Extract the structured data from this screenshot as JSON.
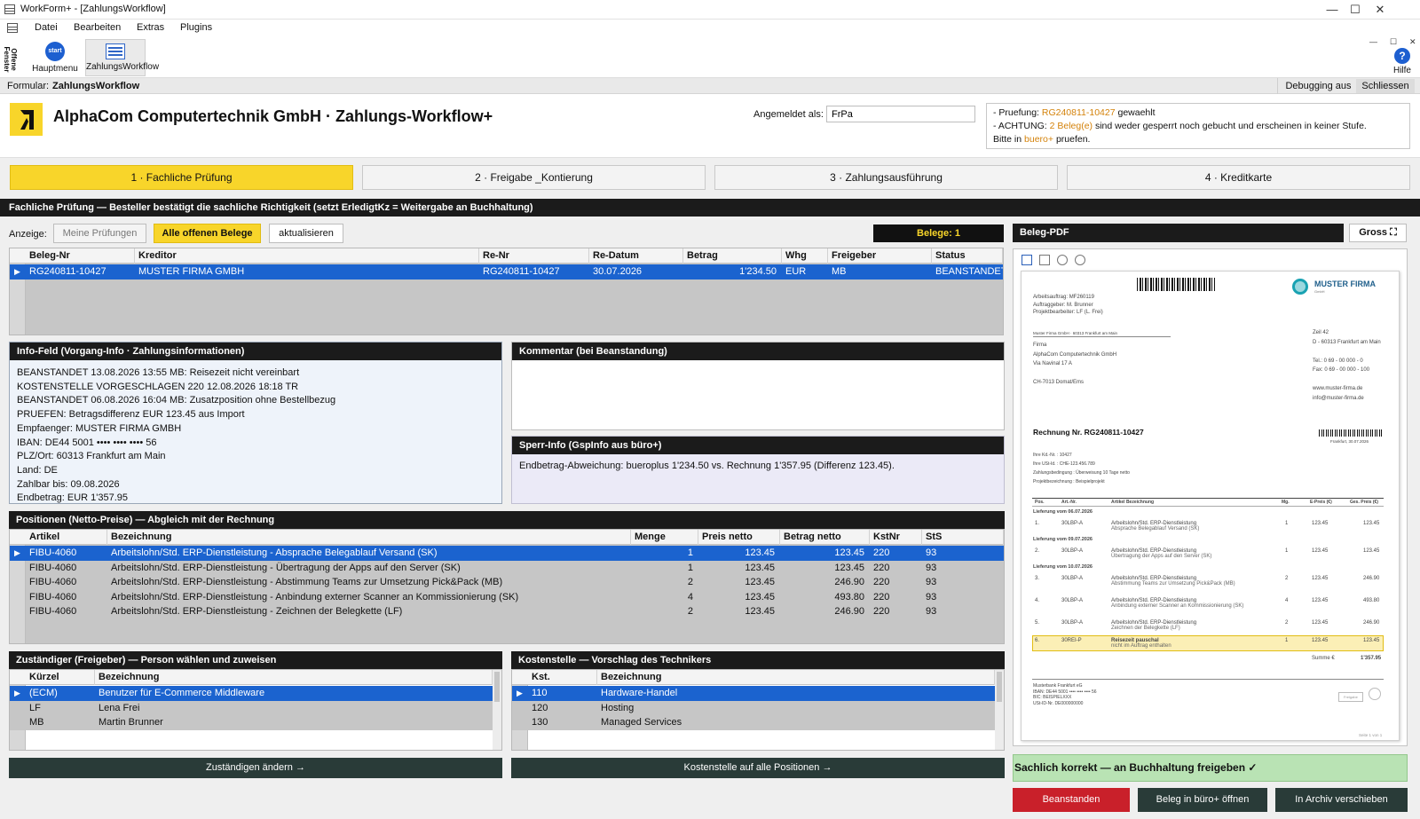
{
  "window": {
    "title": "WorkForm+ - [ZahlungsWorkflow]",
    "minimize": "—",
    "maximize": "☐",
    "close": "✕"
  },
  "menu": [
    "Datei",
    "Bearbeiten",
    "Extras",
    "Plugins"
  ],
  "toolbar": {
    "side_label": "Offene Fenster",
    "items": [
      {
        "label": "Hauptmenu",
        "icon_text": "start"
      },
      {
        "label": "ZahlungsWorkflow"
      }
    ],
    "help_label": "Hilfe",
    "help_glyph": "?",
    "mini_controls": [
      "—",
      "☐",
      "✕"
    ]
  },
  "formbar": {
    "prefix": "Formular:",
    "name": "ZahlungsWorkflow",
    "debug": "Debugging aus",
    "close": "Schliessen"
  },
  "header": {
    "title": "AlphaCom Computertechnik GmbH · Zahlungs-Workflow+",
    "login_label": "Angemeldet als:",
    "login_value": "FrPa",
    "messages": [
      {
        "pre": "- Pruefung: ",
        "hl": "RG240811-10427",
        "post": " gewaehlt"
      },
      {
        "pre": "- ACHTUNG: ",
        "hl": "2 Beleg(e)",
        "post": " sind weder gesperrt noch gebucht und erscheinen in keiner Stufe."
      },
      {
        "pre": "Bitte in ",
        "hl": "buero+",
        "post": " pruefen."
      }
    ]
  },
  "tabs": [
    "1 · Fachliche Prüfung",
    "2 · Freigabe _Kontierung",
    "3 · Zahlungsausführung",
    "4 · Kreditkarte"
  ],
  "banner": "Fachliche Prüfung — Besteller bestätigt die sachliche Richtigkeit (setzt ErledigtKz = Weitergabe an Buchhaltung)",
  "filter": {
    "label": "Anzeige:",
    "mine": "Meine Prüfungen",
    "all": "Alle offenen Belege",
    "refresh": "aktualisieren",
    "count": "Belege: 1"
  },
  "belege": {
    "columns": [
      "Beleg-Nr",
      "Kreditor",
      "Re-Nr",
      "Re-Datum",
      "Betrag",
      "Whg",
      "Freigeber",
      "Status"
    ],
    "rows": [
      [
        "RG240811-10427",
        "MUSTER FIRMA GMBH",
        "RG240811-10427",
        "30.07.2026",
        "1'234.50",
        "EUR",
        "MB",
        "BEANSTANDET"
      ]
    ]
  },
  "info": {
    "title": "Info-Feld (Vorgang-Info · Zahlungsinformationen)",
    "lines": [
      "BEANSTANDET 13.08.2026 13:55 MB: Reisezeit nicht vereinbart",
      "KOSTENSTELLE VORGESCHLAGEN 220 12.08.2026 18:18 TR",
      "BEANSTANDET 06.08.2026 16:04 MB: Zusatzposition ohne Bestellbezug",
      "PRUEFEN: Betragsdifferenz EUR 123.45 aus Import",
      "Empfaenger: MUSTER FIRMA GMBH",
      "IBAN: DE44 5001 •••• •••• •••• 56",
      "PLZ/Ort: 60313 Frankfurt am Main",
      "Land: DE",
      "Zahlbar bis: 09.08.2026",
      "Endbetrag: EUR 1'357.95"
    ]
  },
  "kommentar": {
    "title": "Kommentar (bei Beanstandung)",
    "text": ""
  },
  "sperr": {
    "title": "Sperr-Info (GspInfo aus büro+)",
    "text": "Endbetrag-Abweichung: bueroplus 1'234.50 vs. Rechnung 1'357.95 (Differenz 123.45)."
  },
  "positionen": {
    "title": "Positionen (Netto-Preise) — Abgleich mit der Rechnung",
    "columns": [
      "Artikel",
      "Bezeichnung",
      "Menge",
      "Preis netto",
      "Betrag netto",
      "KstNr",
      "StS"
    ],
    "rows": [
      [
        "FIBU-4060",
        "Arbeitslohn/Std. ERP-Dienstleistung - Absprache Belegablauf Versand (SK)",
        "1",
        "123.45",
        "123.45",
        "220",
        "93"
      ],
      [
        "FIBU-4060",
        "Arbeitslohn/Std. ERP-Dienstleistung - Übertragung der Apps auf den Server (SK)",
        "1",
        "123.45",
        "123.45",
        "220",
        "93"
      ],
      [
        "FIBU-4060",
        "Arbeitslohn/Std. ERP-Dienstleistung - Abstimmung Teams zur Umsetzung Pick&Pack (MB)",
        "2",
        "123.45",
        "246.90",
        "220",
        "93"
      ],
      [
        "FIBU-4060",
        "Arbeitslohn/Std. ERP-Dienstleistung - Anbindung externer Scanner an Kommissionierung (SK)",
        "4",
        "123.45",
        "493.80",
        "220",
        "93"
      ],
      [
        "FIBU-4060",
        "Arbeitslohn/Std. ERP-Dienstleistung - Zeichnen der Belegkette (LF)",
        "2",
        "123.45",
        "246.90",
        "220",
        "93"
      ]
    ]
  },
  "zustaendig": {
    "title": "Zuständiger (Freigeber) — Person wählen und zuweisen",
    "columns": [
      "Kürzel",
      "Bezeichnung"
    ],
    "rows": [
      [
        "(ECM)",
        "Benutzer für E-Commerce Middleware"
      ],
      [
        "LF",
        "Lena Frei"
      ],
      [
        "MB",
        "Martin Brunner"
      ]
    ],
    "button": "Zuständigen ändern →"
  },
  "kostenstelle": {
    "title": "Kostenstelle — Vorschlag des Technikers",
    "columns": [
      "Kst.",
      "Bezeichnung"
    ],
    "rows": [
      [
        "110",
        "Hardware-Handel"
      ],
      [
        "120",
        "Hosting"
      ],
      [
        "130",
        "Managed Services"
      ]
    ],
    "button": "Kostenstelle auf alle Positionen →"
  },
  "pdf": {
    "title": "Beleg-PDF",
    "gross": "Gross ⛶",
    "doc": {
      "left_meta": [
        "Arbeitsauftrag: MF260119",
        "Auftraggeber: M. Brunner",
        "Projektbearbeiter: LF (L. Frei)"
      ],
      "brand": "MUSTER FIRMA",
      "brand_sub": "GmbH",
      "sender_line": "Muster Firma GmbH · 60313 Frankfurt am Main",
      "recipient": [
        "Firma",
        "AlphaCom Computertechnik GmbH",
        "Via Navinal 17 A",
        "",
        "CH-7013 Domat/Ems"
      ],
      "right_addr": [
        "Zeil 42",
        "D - 60313 Frankfurt am Main",
        "",
        "Tel.: 0 69 - 00 000 - 0",
        "Fax: 0 69 - 00 000 - 100",
        "",
        "www.muster-firma.de",
        "info@muster-firma.de"
      ],
      "invoice_title": "Rechnung Nr. RG240811-10427",
      "date_line": "Frankfurt, 30.07.2026",
      "meta": [
        "Ihre Kd.-Nr.    : 10427",
        "Ihre USt-Id.    : CHE-123.456.789",
        "Zahlungsbedingung : Überweisung 10 Tage netto",
        "Projektbezeichnung : Beispielprojekt"
      ],
      "cols": [
        "Pos.",
        "Art.-Nr.",
        "Artikel Bezeichnung",
        "Mg.",
        "E-Preis (€)",
        "Ges. Preis (€)"
      ],
      "groups": [
        {
          "label": "Lieferung vom 06.07.2026",
          "items": [
            [
              "1.",
              "30LBP-A",
              "Arbeitslohn/Std. ERP-Dienstleistung",
              "Absprache Belegablauf Versand (SK)",
              "1",
              "123.45",
              "123.45"
            ]
          ]
        },
        {
          "label": "Lieferung vom 09.07.2026",
          "items": [
            [
              "2.",
              "30LBP-A",
              "Arbeitslohn/Std. ERP-Dienstleistung",
              "Übertragung der Apps auf den Server (SK)",
              "1",
              "123.45",
              "123.45"
            ]
          ]
        },
        {
          "label": "Lieferung vom 10.07.2026",
          "items": [
            [
              "3.",
              "30LBP-A",
              "Arbeitslohn/Std. ERP-Dienstleistung",
              "Abstimmung Teams zur Umsetzung Pick&Pack (MB)",
              "2",
              "123.45",
              "246.90"
            ],
            [
              "4.",
              "30LBP-A",
              "Arbeitslohn/Std. ERP-Dienstleistung",
              "Anbindung externer Scanner an Kommissionierung (SK)",
              "4",
              "123.45",
              "493.80"
            ],
            [
              "5.",
              "30LBP-A",
              "Arbeitslohn/Std. ERP-Dienstleistung",
              "Zeichnen der Belegkette (LF)",
              "2",
              "123.45",
              "246.90"
            ]
          ]
        }
      ],
      "extra": [
        "6.",
        "30REI-P",
        "Reisezeit pauschal",
        "nicht im Auftrag enthalten",
        "1",
        "123.45",
        "123.45"
      ],
      "sum_label": "Summe €",
      "sum": "1'357.95",
      "bank": [
        "Musterbank Frankfurt eG",
        "IBAN: DE44 5001 •••• •••• •••• 56",
        "BIC: BEISPIELXXX",
        "USt-ID-Nr. DE000000000"
      ],
      "page": "Seite 1 von 1",
      "stamp": "Freigabe"
    }
  },
  "actions": {
    "approve": "Sachlich korrekt — an Buchhaltung freigeben ✓",
    "reject": "Beanstanden",
    "open": "Beleg in büro+ öffnen",
    "archive": "In Archiv verschieben"
  },
  "colors": {
    "accent": "#f8d52a",
    "selection": "#1b63cf",
    "dark": "#1b1b1b",
    "approve": "#b9e3b4",
    "reject": "#c9202a",
    "highlight": "#d4820a"
  }
}
